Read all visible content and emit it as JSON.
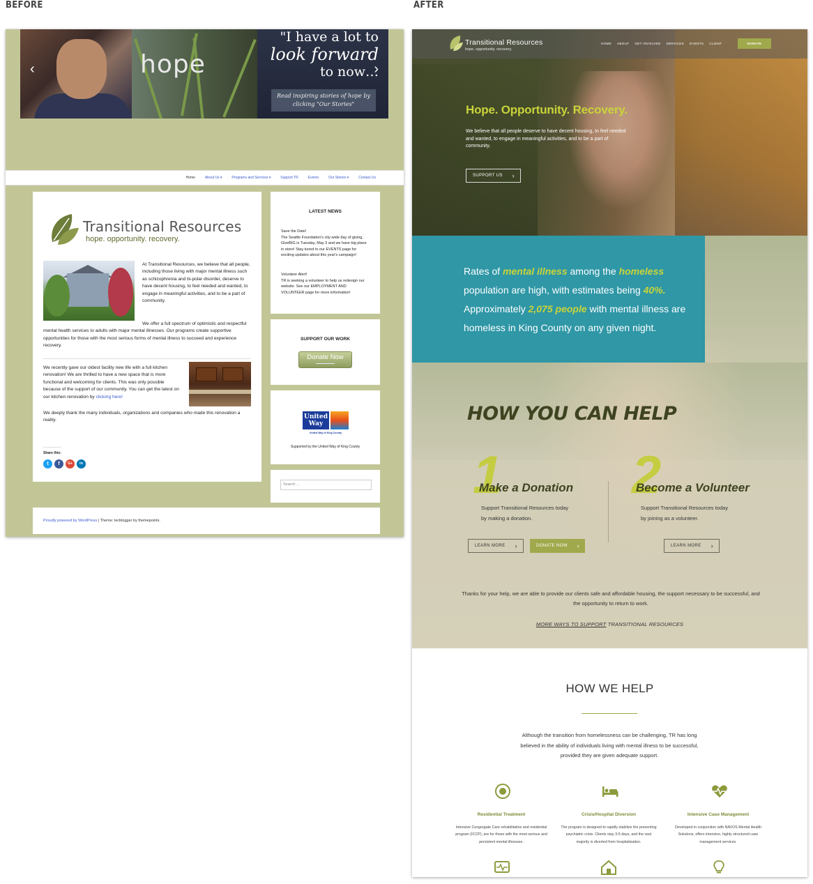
{
  "labels": {
    "before": "BEFORE",
    "after": "AFTER"
  },
  "before": {
    "slider": {
      "word": "hope",
      "quote_line1": "\"I have a lot to",
      "quote_line2": "look forward",
      "quote_line3": "to now…",
      "cta": "Read inspiring stories of hope by clicking \"Our Stories\"",
      "prev": "‹",
      "next": "›"
    },
    "nav": [
      "Home",
      "About Us ▾",
      "Programs and Services ▾",
      "Support TR",
      "Events",
      "Our Stories ▾",
      "Contact Us"
    ],
    "logo": {
      "name": "Transitional Resources",
      "tagline": "hope. opportunity. recovery."
    },
    "para1": "At Transitional Resources, we believe that all people, including those living with major mental illness such as schizophrenia and bi-polar disorder, deserve to have decent housing, to feel needed and wanted, to engage in meaningful activities, and to be a part of community.",
    "para2": "We offer a full spectrum of optimistic and respectful mental health services to adults with major mental illnesses. Our programs create supportive opportunities for those with the most serious forms of mental illness to succeed and experience recovery.",
    "para3_before_link": "We recently gave our oldest facility new life with a full kitchen renovation! We are thrilled to have a new space that is more functional and welcoming for clients. This was only possible because of the support of our community. You can get the latest on our kitchen renovation by ",
    "para3_link": "clicking here!",
    "para4": "We deeply thank the many individuals, organizations and companies who made this renovation a reality.",
    "share_label": "Share this:",
    "share_icons": [
      "t",
      "f",
      "G+",
      "in"
    ],
    "latest_news": {
      "title": "LATEST NEWS",
      "item1": "Save the Date!\nThe Seattle Foundation's city-wide day of giving, GiveBIG is Tuesday, May 3 and we have big plans in store! Stay tuned to our EVENTS page for exciting updates about this year's campaign!",
      "item2": "Volunteer Alert!\nTR is seeking a volunteer to help us redesign our website. See our EMPLOYMENT AND VOLUNTEER page for more information!"
    },
    "support": {
      "title": "SUPPORT OUR WORK",
      "button": "Donate Now"
    },
    "united_way": {
      "line1": "United",
      "line2": "Way",
      "sub": "United Way of King County",
      "caption": "Supported by the United Way of King County"
    },
    "search_placeholder": "Search ...",
    "footer": {
      "link": "Proudly powered by WordPress",
      "rest": " | Theme: tecblogger by themepoints."
    }
  },
  "after": {
    "logo": {
      "name": "Transitional Resources",
      "tagline": "hope. opportunity. recovery."
    },
    "nav": [
      "HOME",
      "ABOUT",
      "GET INVOLVED",
      "SERVICES",
      "EVENTS",
      "CLIENT"
    ],
    "donate": "DONATE",
    "hero": {
      "title": "Hope. Opportunity. Recovery.",
      "desc": "We believe that all people deserve to have decent housing, to feel needed and wanted, to engage in meaningful activities, and to be a part of community.",
      "button": "SUPPORT US"
    },
    "stat": {
      "p1": "Rates of ",
      "e1": "mental illness",
      "p2": " among the ",
      "e2": "homeless",
      "p3": " population are high, with estimates being ",
      "e3": "40%.",
      "p4": " Approximately ",
      "e4": "2,075 people",
      "p5": " with mental illness are homeless in King County on any given night."
    },
    "help": {
      "title": "HOW YOU CAN HELP",
      "col1": {
        "num": "1",
        "title": "Make a Donation",
        "text": "Support Transitional Resources today by making a donation.",
        "btn1": "LEARN MORE",
        "btn2": "DONATE NOW"
      },
      "col2": {
        "num": "2",
        "title": "Become a Volunteer",
        "text": "Support Transitional Resources today by joining as a volunteer.",
        "btn1": "LEARN MORE"
      },
      "chevron": "›",
      "thanks": "Thanks for your help, we are able to provide our clients safe and affordable housing, the support necessary to be successful, and the opportunity to return to work.",
      "more_link": "MORE WAYS TO SUPPORT",
      "more_rest": " TRANSITIONAL RESOURCES"
    },
    "how_we_help": {
      "title": "HOW WE HELP",
      "text": "Although the transition from homelessness can be challenging, TR has long believed in the ability of individuals living with mental illness to be successful, provided they are given adequate support.",
      "services": [
        {
          "icon": "target-icon",
          "title": "Residential Treatment",
          "desc": "Intensive Congregate Care rehabilitative and residential program (ICCP), are for those with the most serious and persistent mental illnesses."
        },
        {
          "icon": "bed-icon",
          "title": "Crisis/Hospital Diversion",
          "desc": "The program is designed to rapidly stabilize the presenting psychiatric crisis. Clients stay 3-5 days, and the vast majority is diverted from hospitalization."
        },
        {
          "icon": "heartbeat-icon",
          "title": "Intensive Case Management",
          "desc": "Developed in conjunction with NAVOS Mental Health Solutions, offers intensive, highly structured case management services."
        }
      ],
      "more_icons": [
        "pulse-monitor-icon",
        "house-icon",
        "lightbulb-icon"
      ]
    },
    "accent": "#a0a94b",
    "teal": "#2f97a6"
  }
}
